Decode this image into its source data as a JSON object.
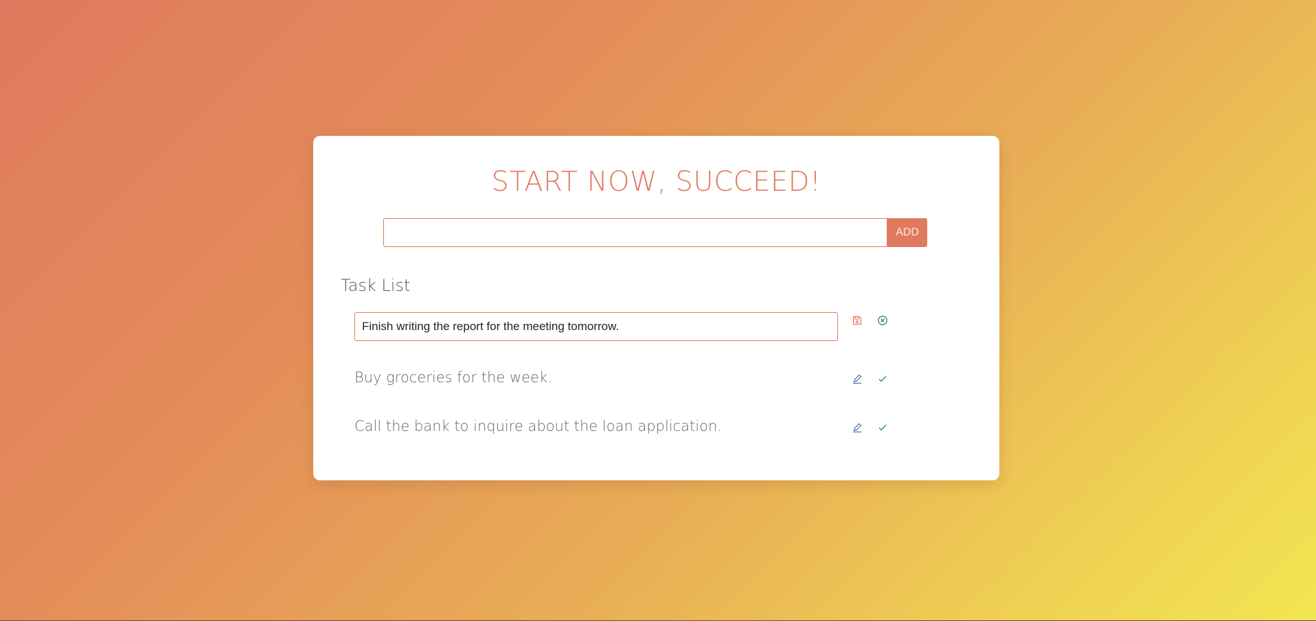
{
  "header": {
    "title": "START NOW, SUCCEED!"
  },
  "add_form": {
    "input_value": "",
    "input_placeholder": "",
    "button_label": "ADD"
  },
  "task_list": {
    "title": "Task List",
    "tasks": [
      {
        "text": "Finish writing the report for the meeting tomorrow.",
        "state": "editing",
        "actions": [
          "save-icon",
          "cancel-icon"
        ]
      },
      {
        "text": "Buy groceries for the week.",
        "state": "view",
        "actions": [
          "edit-icon",
          "check-icon"
        ]
      },
      {
        "text": "Call the bank to inquire about the loan application.",
        "state": "view",
        "actions": [
          "edit-icon",
          "check-icon"
        ]
      }
    ]
  },
  "colors": {
    "accent": "#e07a5f",
    "edit_icon": "#4a6fa5",
    "check_icon": "#2e8b57",
    "gradient_start": "#e07a5f",
    "gradient_end": "#f2e552"
  }
}
